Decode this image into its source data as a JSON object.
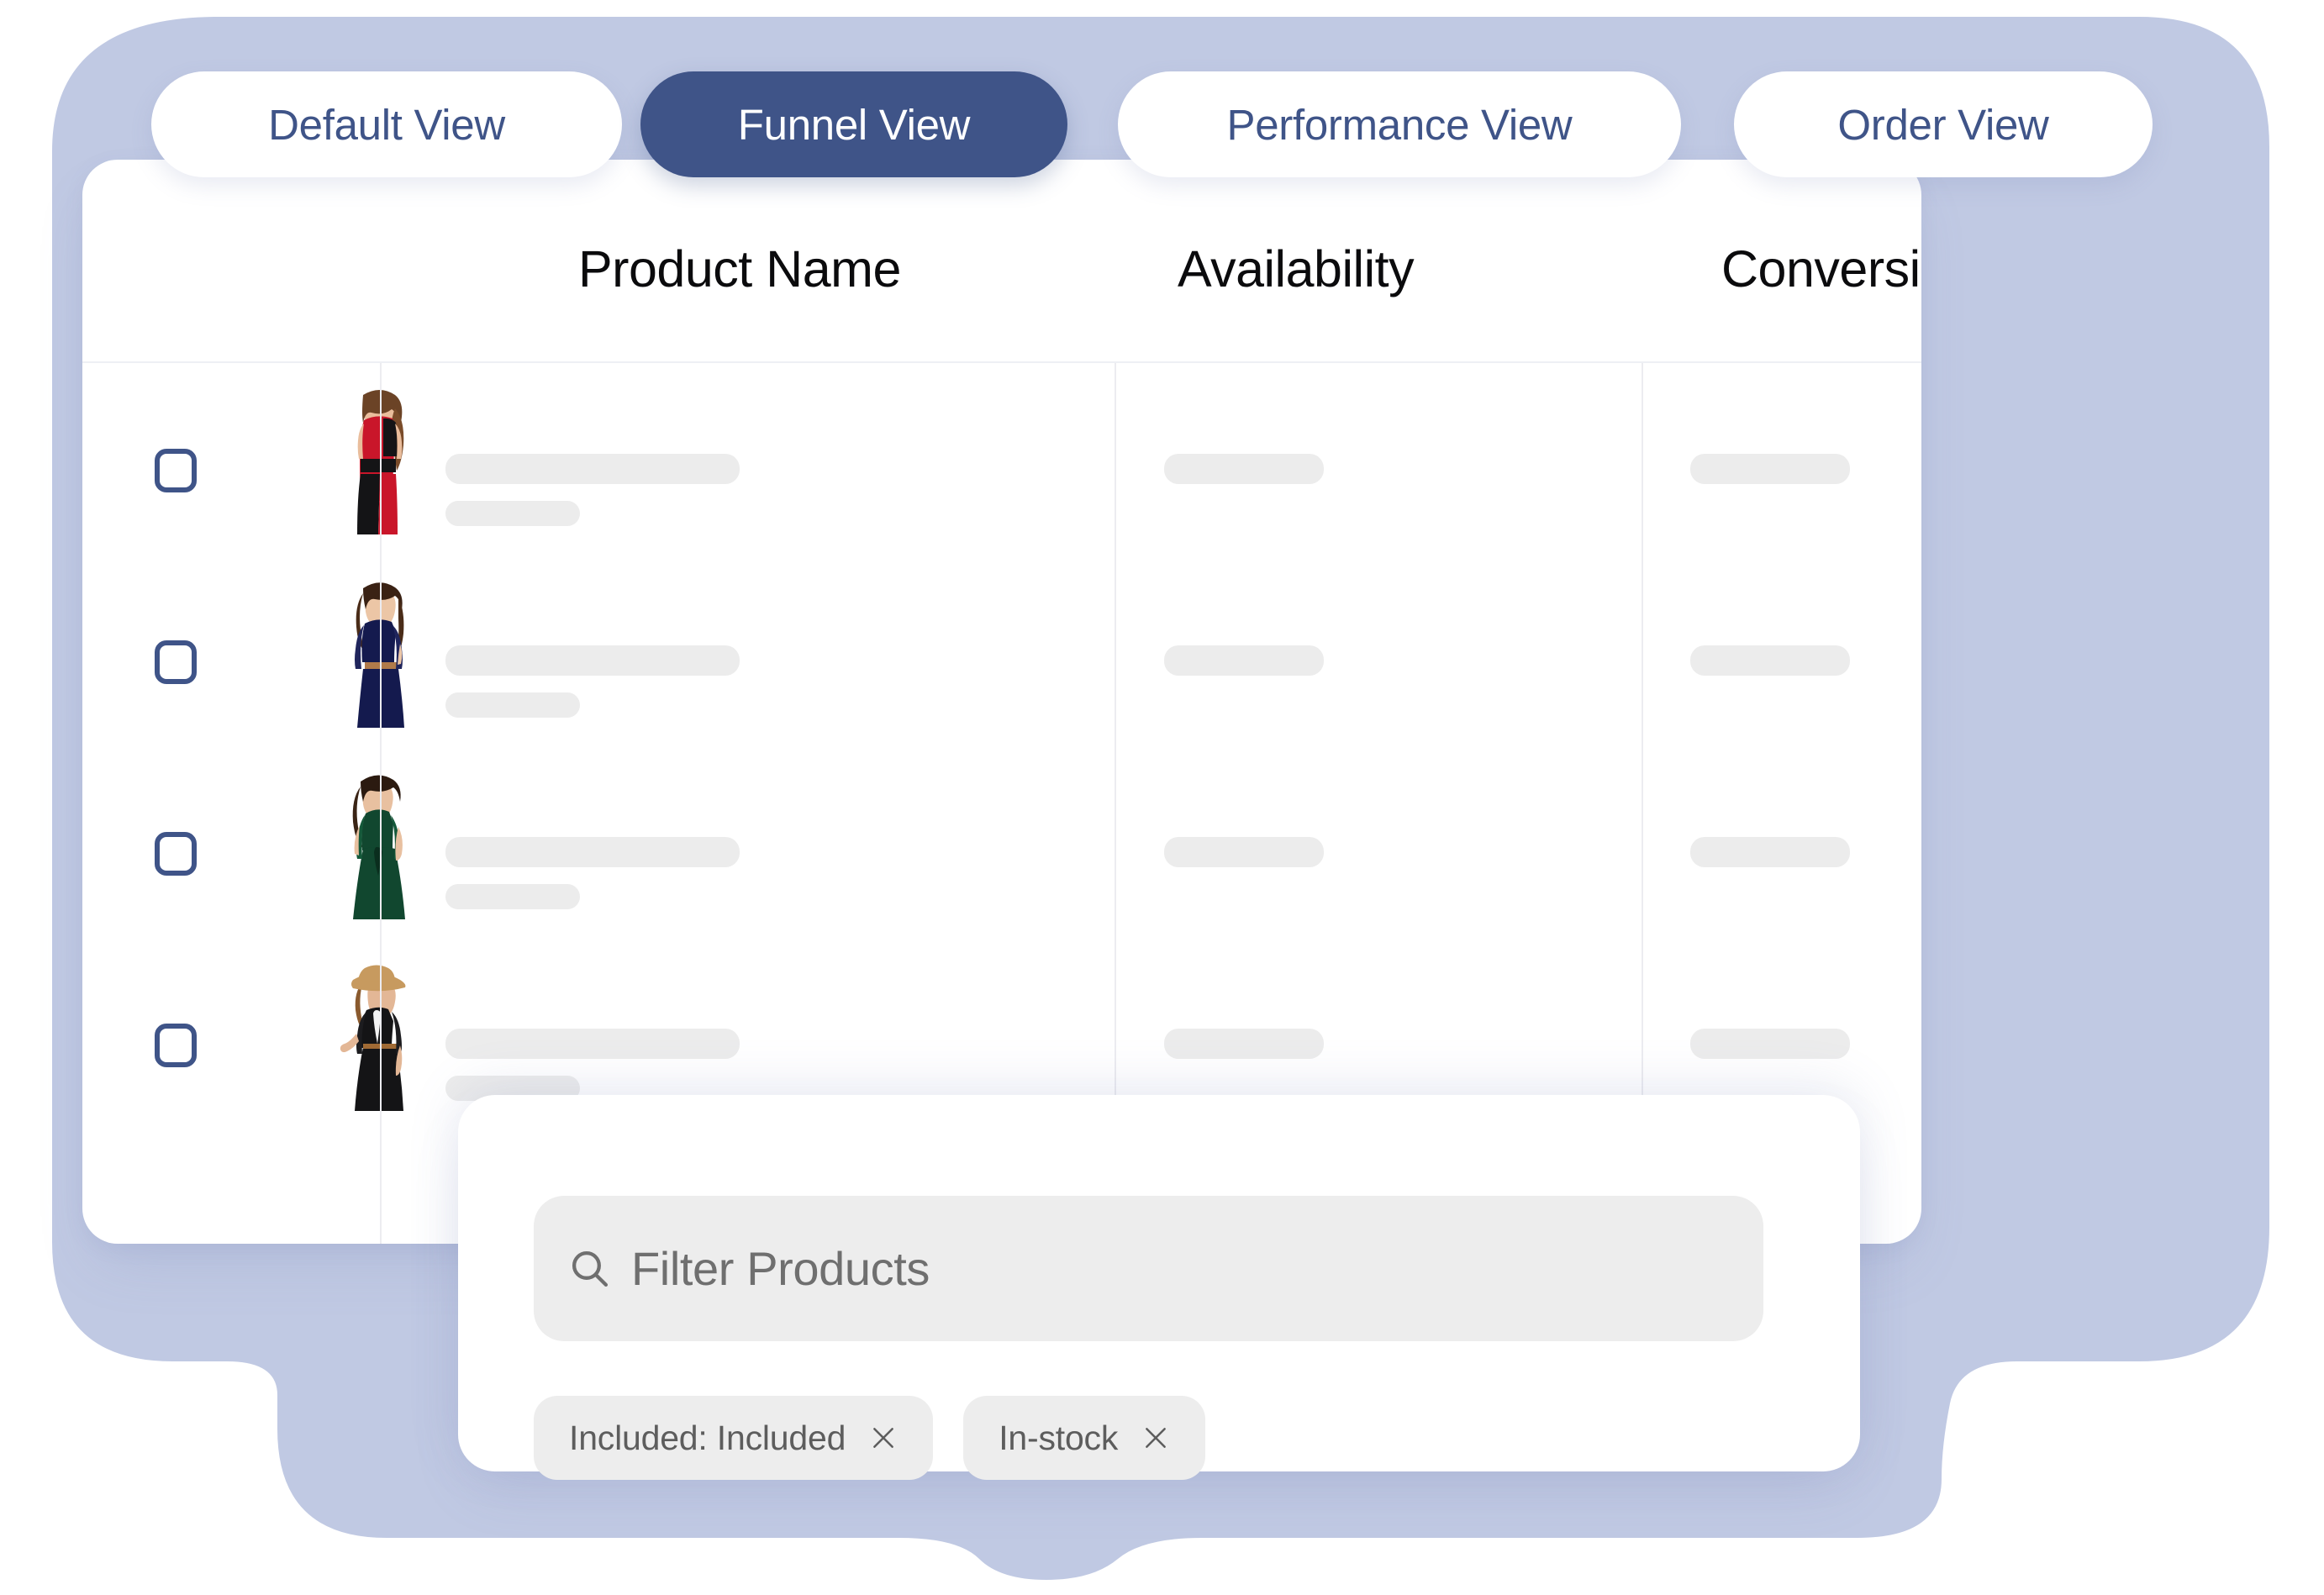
{
  "theme": {
    "backdrop_color": "#c0c9e3",
    "accent_color": "#3f5488",
    "card_color": "#ffffff",
    "skeleton_color": "#ececec",
    "field_color": "#ededed",
    "header_text_color": "#0b0b0d",
    "muted_text_color": "#6f6f6f"
  },
  "tabs": [
    {
      "label": "Default View",
      "active": false
    },
    {
      "label": "Funnel View",
      "active": true
    },
    {
      "label": "Performance View",
      "active": false
    },
    {
      "label": "Order View",
      "active": false
    }
  ],
  "table": {
    "columns": [
      {
        "label": "Product Name"
      },
      {
        "label": "Availability"
      },
      {
        "label": "Conversion Rate"
      }
    ],
    "rows": [
      {
        "selected": false,
        "thumbnail": "product-thumbnail-red-black-dress",
        "name_placeholder": "",
        "name_sub_placeholder": "",
        "availability_placeholder": "",
        "conversion_rate_placeholder": ""
      },
      {
        "selected": false,
        "thumbnail": "product-thumbnail-navy-lace-dress",
        "name_placeholder": "",
        "name_sub_placeholder": "",
        "availability_placeholder": "",
        "conversion_rate_placeholder": ""
      },
      {
        "selected": false,
        "thumbnail": "product-thumbnail-green-dress",
        "name_placeholder": "",
        "name_sub_placeholder": "",
        "availability_placeholder": "",
        "conversion_rate_placeholder": ""
      },
      {
        "selected": false,
        "thumbnail": "product-thumbnail-black-dress-with-hat",
        "name_placeholder": "",
        "name_sub_placeholder": "",
        "availability_placeholder": "",
        "conversion_rate_placeholder": ""
      }
    ]
  },
  "filter_panel": {
    "search": {
      "icon": "search-icon",
      "value": "",
      "placeholder": "Filter Products"
    },
    "chips": [
      {
        "label": "Included: Included",
        "remove_icon": "close-icon"
      },
      {
        "label": "In-stock",
        "remove_icon": "close-icon"
      }
    ]
  }
}
